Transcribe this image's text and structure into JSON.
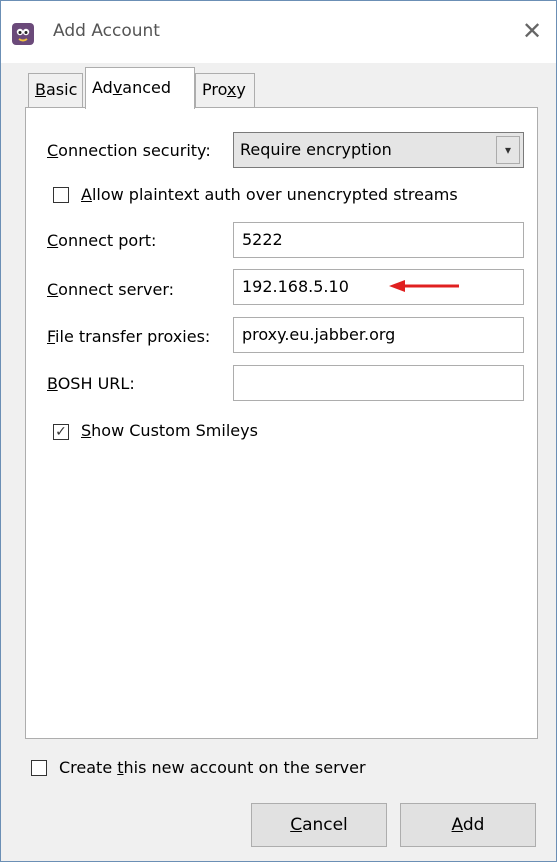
{
  "window": {
    "title": "Add Account",
    "close_glyph": "✕"
  },
  "tabs": [
    {
      "label_pre": "",
      "label_u": "B",
      "label_post": "asic"
    },
    {
      "label_pre": "Ad",
      "label_u": "v",
      "label_post": "anced"
    },
    {
      "label_pre": "Pro",
      "label_u": "x",
      "label_post": "y"
    }
  ],
  "advanced": {
    "connection_security": {
      "label_u": "C",
      "label_post": "onnection security:",
      "value": "Require encryption"
    },
    "allow_plaintext": {
      "label_u": "A",
      "label_post": "llow plaintext auth over unencrypted streams",
      "checked": false
    },
    "connect_port": {
      "label_u": "C",
      "label_post": "onnect port:",
      "value": "5222"
    },
    "connect_server": {
      "label_u": "C",
      "label_post": "onnect server:",
      "value": "192.168.5.10"
    },
    "file_transfer_proxies": {
      "label_u": "F",
      "label_post": "ile transfer proxies:",
      "value": "proxy.eu.jabber.org"
    },
    "bosh_url": {
      "label_u": "B",
      "label_post": "OSH URL:",
      "value": ""
    },
    "show_custom_smileys": {
      "label_u": "S",
      "label_post": "how Custom Smileys",
      "checked": true,
      "check_glyph": "✓"
    }
  },
  "create_account": {
    "label_pre": "Create ",
    "label_u": "t",
    "label_post": "his new account on the server",
    "checked": false
  },
  "buttons": {
    "cancel": {
      "label_u": "C",
      "label_post": "ancel"
    },
    "add": {
      "label_u": "A",
      "label_post": "dd"
    }
  },
  "colors": {
    "annotation_arrow": "#e02020"
  }
}
